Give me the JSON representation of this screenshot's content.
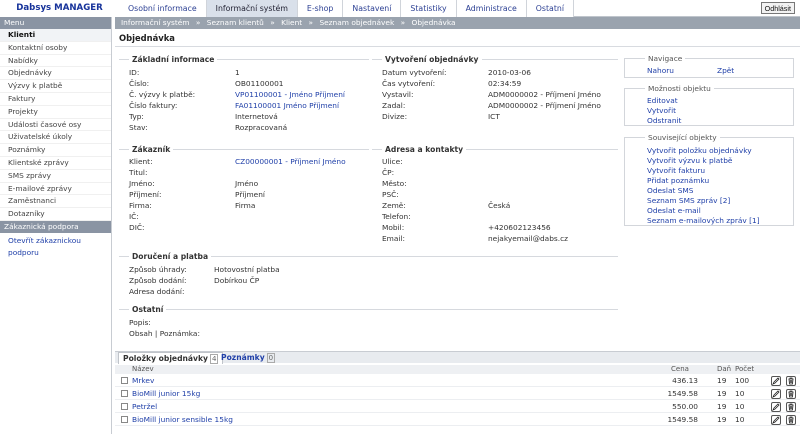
{
  "app": {
    "title": "Dabsys MANAGER",
    "logout_label": "Odhlásit"
  },
  "topnav": [
    {
      "label": "Osobní informace"
    },
    {
      "label": "Informační systém"
    },
    {
      "label": "E-shop"
    },
    {
      "label": "Nastavení"
    },
    {
      "label": "Statistiky"
    },
    {
      "label": "Administrace"
    },
    {
      "label": "Ostatní"
    }
  ],
  "sidebar": {
    "menu_heading": "Menu",
    "items": [
      {
        "label": "Klienti"
      },
      {
        "label": "Kontaktní osoby"
      },
      {
        "label": "Nabídky"
      },
      {
        "label": "Objednávky"
      },
      {
        "label": "Výzvy k platbě"
      },
      {
        "label": "Faktury"
      },
      {
        "label": "Projekty"
      },
      {
        "label": "Události časové osy"
      },
      {
        "label": "Uživatelské úkoly"
      },
      {
        "label": "Poznámky"
      },
      {
        "label": "Klientské zprávy"
      },
      {
        "label": "SMS zprávy"
      },
      {
        "label": "E-mailové zprávy"
      },
      {
        "label": "Zaměstnanci"
      },
      {
        "label": "Dotazníky"
      }
    ],
    "support_heading": "Zákaznická podpora",
    "support_link": "Otevřít zákaznickou podporu"
  },
  "breadcrumb": [
    "Informační systém",
    "»",
    "Seznam klientů",
    "»",
    "Klient",
    "»",
    "Seznam objednávek",
    "»",
    "Objednávka"
  ],
  "page_title": "Objednávka",
  "basic": {
    "legend": "Základní informace",
    "id_label": "ID:",
    "id": "1",
    "number_label": "Číslo:",
    "number": "OB01100001",
    "payment_label": "Č. výzvy k platbě:",
    "payment": "VP01100001 - Jméno Příjmení",
    "invoice_label": "Číslo faktury:",
    "invoice": "FA01100001 Jméno Příjmení",
    "type_label": "Typ:",
    "type": "Internetová",
    "state_label": "Stav:",
    "state": "Rozpracovaná"
  },
  "created": {
    "legend": "Vytvoření objednávky",
    "date_label": "Datum vytvoření:",
    "date": "2010-03-06",
    "time_label": "Čas vytvoření:",
    "time": "02:34:59",
    "issuer_label": "Vystavil:",
    "issuer": "ADM0000002 - Příjmení Jméno",
    "entered_label": "Zadal:",
    "entered": "ADM0000002 - Příjmení Jméno",
    "division_label": "Divize:",
    "division": "ICT"
  },
  "customer": {
    "legend": "Zákazník",
    "client_label": "Klient:",
    "client": "CZ00000001 - Příjmení Jméno",
    "title_label": "Titul:",
    "title": "",
    "firstname_label": "Jméno:",
    "firstname": "Jméno",
    "lastname_label": "Příjmení:",
    "lastname": "Příjmení",
    "company_label": "Firma:",
    "company": "Firma",
    "ic_label": "IČ:",
    "ic": "",
    "dic_label": "DIČ:",
    "dic": ""
  },
  "address": {
    "legend": "Adresa a kontakty",
    "street_label": "Ulice:",
    "street": "",
    "cp_label": "ČP:",
    "cp": "",
    "city_label": "Město:",
    "city": "",
    "psc_label": "PSČ:",
    "psc": "",
    "country_label": "Země:",
    "country": "Česká",
    "phone_label": "Telefon:",
    "phone": "",
    "mobile_label": "Mobil:",
    "mobile": "+420602123456",
    "email_label": "Email:",
    "email": "nejakyemail@dabs.cz"
  },
  "delivery": {
    "legend": "Doručení a platba",
    "payment_label": "Způsob úhrady:",
    "payment": "Hotovostní platba",
    "shipping_label": "Způsob dodání:",
    "shipping": "Dobírkou ČP",
    "address_label": "Adresa dodání:",
    "address": ""
  },
  "other": {
    "legend": "Ostatní",
    "desc_label": "Popis:",
    "desc": "",
    "content_label": "Obsah | Poznámka:",
    "content": ""
  },
  "nav_panel": {
    "legend": "Navigace",
    "up": "Nahoru",
    "back": "Zpět"
  },
  "options_panel": {
    "legend": "Možnosti objektu",
    "edit": "Editovat",
    "create": "Vytvořit",
    "remove": "Odstranit"
  },
  "related_panel": {
    "legend": "Související objekty",
    "links": [
      "Vytvořit položku objednávky",
      "Vytvořit výzvu k platbě",
      "Vytvořit fakturu",
      "Přidat poznámku",
      "Odeslat SMS",
      "Seznam SMS zpráv [2]",
      "Odeslat e-mail",
      "Seznam e-mailových zpráv [1]"
    ]
  },
  "items_tabs": {
    "items_label": "Položky objednávky",
    "items_count": "4",
    "notes_label": "Poznámky",
    "notes_count": "0"
  },
  "items_table": {
    "headers": {
      "name": "Název",
      "price": "Cena",
      "vat": "Daň",
      "qty": "Počet"
    },
    "rows": [
      {
        "name": "Mrkev",
        "price": "436.13",
        "vat": "19",
        "qty": "100"
      },
      {
        "name": "BioMill junior 15kg",
        "price": "1549.58",
        "vat": "19",
        "qty": "10"
      },
      {
        "name": "Petržel",
        "price": "550.00",
        "vat": "19",
        "qty": "10"
      },
      {
        "name": "BioMill junior sensible 15kg",
        "price": "1549.58",
        "vat": "19",
        "qty": "10"
      }
    ]
  },
  "colors": {
    "accent": "#1f3fa8",
    "header_bar": "#9aa3ae",
    "sidebar_head": "#8a94a3"
  }
}
